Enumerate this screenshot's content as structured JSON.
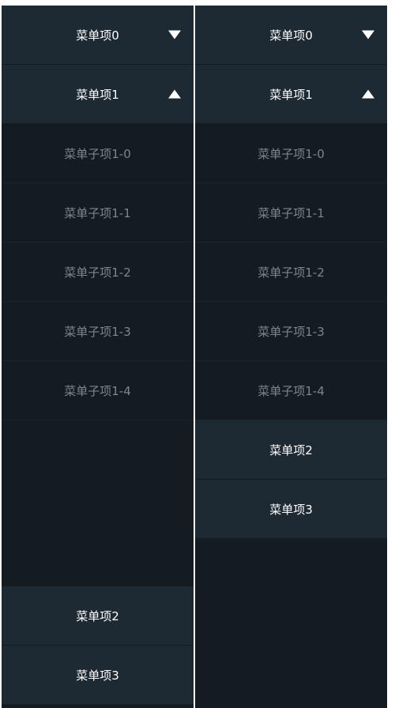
{
  "left_menu": {
    "items": [
      {
        "label": "菜单项0"
      },
      {
        "label": "菜单项1"
      },
      {
        "label": "菜单项2"
      },
      {
        "label": "菜单项3"
      }
    ],
    "submenu": [
      {
        "label": "菜单子项1-0"
      },
      {
        "label": "菜单子项1-1"
      },
      {
        "label": "菜单子项1-2"
      },
      {
        "label": "菜单子项1-3"
      },
      {
        "label": "菜单子项1-4"
      }
    ]
  },
  "right_menu": {
    "items": [
      {
        "label": "菜单项0"
      },
      {
        "label": "菜单项1"
      },
      {
        "label": "菜单项2"
      },
      {
        "label": "菜单项3"
      }
    ],
    "submenu": [
      {
        "label": "菜单子项1-0"
      },
      {
        "label": "菜单子项1-1"
      },
      {
        "label": "菜单子项1-2"
      },
      {
        "label": "菜单子项1-3"
      },
      {
        "label": "菜单子项1-4"
      }
    ]
  },
  "colors": {
    "panel_bg": "#141b21",
    "menu_item_bg": "#1e2a33",
    "menu_text": "#ffffff",
    "submenu_text": "#7c868e"
  },
  "icons": {
    "collapsed": "triangle-down-icon",
    "expanded": "triangle-up-icon"
  }
}
